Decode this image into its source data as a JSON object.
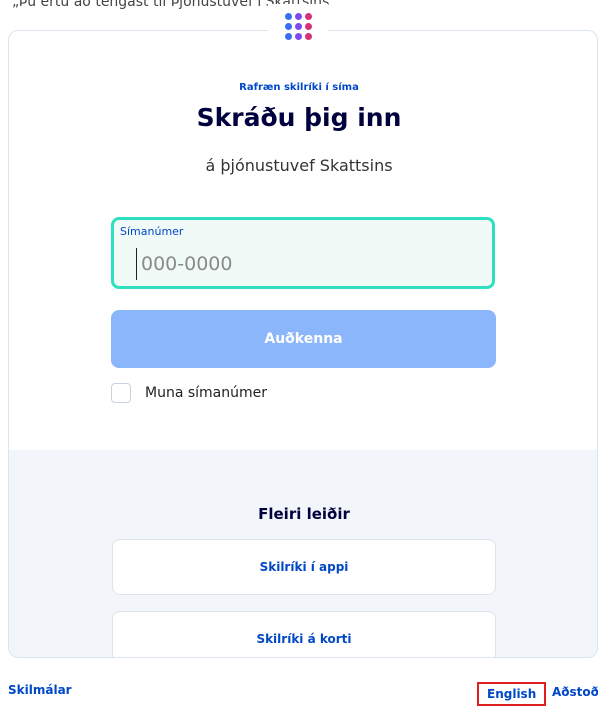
{
  "header": {
    "snippet": "„Þú ertu ao tengast til Þjónustuvef í Skattsins“"
  },
  "login": {
    "eyebrow": "Rafræn skilríki í síma",
    "title": "Skráðu þig inn",
    "description": "á þjónustuvef Skattsins",
    "phone_label": "Símanúmer",
    "phone_placeholder": "000-0000",
    "phone_value": "",
    "submit_label": "Auðkenna",
    "remember_label": "Muna símanúmer",
    "remember_checked": false
  },
  "alternatives": {
    "title": "Fleiri leiðir",
    "app_label": "Skilríki í appi",
    "card_label": "Skilríki á korti"
  },
  "footer": {
    "terms": "Skilmálar",
    "language": "English",
    "help": "Aðstoð"
  },
  "colors": {
    "accent": "#0048c8",
    "focus_border": "#2ee0c0",
    "button_disabled": "#8cb6fb",
    "highlight": "#e02020",
    "section_bg": "#f2f6fb"
  },
  "logo": {
    "dot_colors": [
      "#3b6df0",
      "#7a4cf0",
      "#d6307a",
      "#3b6df0",
      "#7a4cf0",
      "#d6307a",
      "#3b6df0",
      "#7a4cf0",
      "#d6307a"
    ]
  }
}
